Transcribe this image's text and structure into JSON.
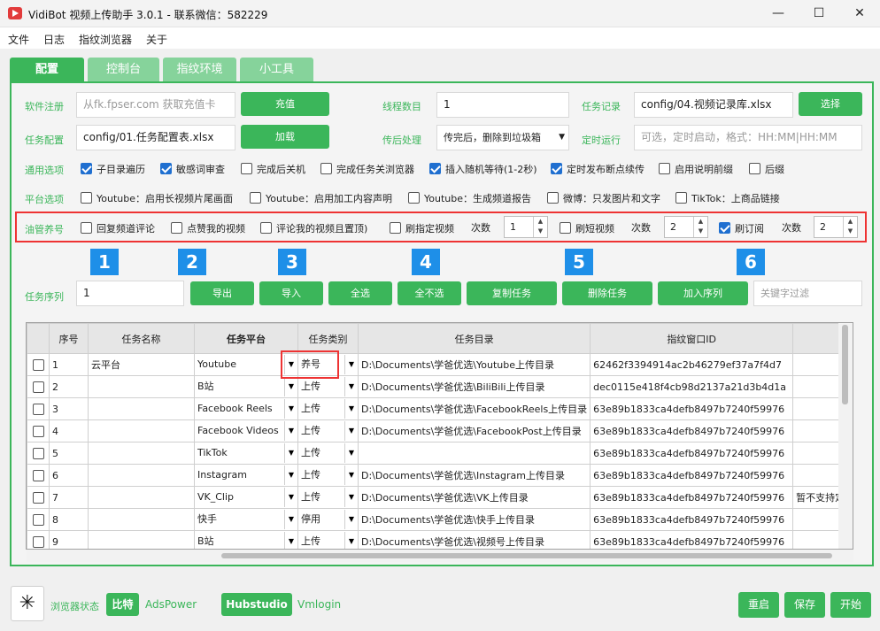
{
  "window": {
    "title": "VidiBot 视频上传助手 3.0.1 - 联系微信：582229"
  },
  "menu": [
    "文件",
    "日志",
    "指纹浏览器",
    "关于"
  ],
  "tabs": [
    "配置",
    "控制台",
    "指纹环境",
    "小工具"
  ],
  "config": {
    "reg_label": "软件注册",
    "reg_placeholder": "从fk.fpser.com 获取充值卡",
    "recharge_btn": "充值",
    "thread_label": "线程数目",
    "thread_value": "1",
    "record_label": "任务记录",
    "record_value": "config/04.视频记录库.xlsx",
    "select_btn": "选择",
    "task_config_label": "任务配置",
    "task_config_value": "config/01.任务配置表.xlsx",
    "load_btn": "加载",
    "post_label": "传后处理",
    "post_value": "传完后，删除到垃圾箱",
    "schedule_label": "定时运行",
    "schedule_placeholder": "可选，定时启动，格式：HH:MM|HH:MM"
  },
  "general": {
    "label": "通用选项",
    "options": [
      {
        "text": "子目录遍历",
        "checked": true
      },
      {
        "text": "敏感词审查",
        "checked": true
      },
      {
        "text": "完成后关机",
        "checked": false
      },
      {
        "text": "完成任务关浏览器",
        "checked": false
      },
      {
        "text": "插入随机等待(1-2秒)",
        "checked": true
      },
      {
        "text": "定时发布断点续传",
        "checked": true
      },
      {
        "text": "启用说明前缀",
        "checked": false
      },
      {
        "text": "后缀",
        "checked": false
      }
    ]
  },
  "platform": {
    "label": "平台选项",
    "options": [
      {
        "text": "Youtube：启用长视频片尾画面",
        "checked": false
      },
      {
        "text": "Youtube：启用加工内容声明",
        "checked": false
      },
      {
        "text": "Youtube：生成频道报告",
        "checked": false
      },
      {
        "text": "微博：只发图片和文字",
        "checked": false
      },
      {
        "text": "TikTok：上商品链接",
        "checked": false
      }
    ]
  },
  "youtube_boost": {
    "label": "油管养号",
    "opt1": "回复频道评论",
    "opt2": "点赞我的视频",
    "opt3": "评论我的视频且置顶)",
    "opt4": "刷指定视频",
    "count_label": "次数",
    "count1": "1",
    "opt5": "刷短视频",
    "count2": "2",
    "opt6": "刷订阅",
    "count3": "2",
    "opt6_checked": true
  },
  "badges": [
    "1",
    "2",
    "3",
    "4",
    "5",
    "6"
  ],
  "sequence": {
    "label": "任务序列",
    "value": "1",
    "buttons": [
      "导出",
      "导入",
      "全选",
      "全不选",
      "复制任务",
      "删除任务",
      "加入序列"
    ],
    "filter_placeholder": "关键字过滤"
  },
  "table": {
    "headers": [
      "序号",
      "任务名称",
      "任务平台",
      "任务类别",
      "任务目录",
      "指纹窗口ID",
      ""
    ],
    "rows": [
      [
        "1",
        "云平台",
        "Youtube",
        "养号",
        "D:\\Documents\\学爸优选\\Youtube上传目录",
        "62462f3394914ac2b46279ef37a7f4d7",
        ""
      ],
      [
        "2",
        "",
        "B站",
        "上传",
        "D:\\Documents\\学爸优选\\BiliBili上传目录",
        "dec0115e418f4cb98d2137a21d3b4d1a",
        ""
      ],
      [
        "3",
        "",
        "Facebook Reels",
        "上传",
        "D:\\Documents\\学爸优选\\FacebookReels上传目录",
        "63e89b1833ca4defb8497b7240f59976",
        ""
      ],
      [
        "4",
        "",
        "Facebook Videos",
        "上传",
        "D:\\Documents\\学爸优选\\FacebookPost上传目录",
        "63e89b1833ca4defb8497b7240f59976",
        ""
      ],
      [
        "5",
        "",
        "TikTok",
        "上传",
        "",
        "63e89b1833ca4defb8497b7240f59976",
        ""
      ],
      [
        "6",
        "",
        "Instagram",
        "上传",
        "D:\\Documents\\学爸优选\\Instagram上传目录",
        "63e89b1833ca4defb8497b7240f59976",
        ""
      ],
      [
        "7",
        "",
        "VK_Clip",
        "上传",
        "D:\\Documents\\学爸优选\\VK上传目录",
        "63e89b1833ca4defb8497b7240f59976",
        "暂不支持定"
      ],
      [
        "8",
        "",
        "快手",
        "停用",
        "D:\\Documents\\学爸优选\\快手上传目录",
        "63e89b1833ca4defb8497b7240f59976",
        ""
      ],
      [
        "9",
        "",
        "B站",
        "上传",
        "D:\\Documents\\学爸优选\\视频号上传目录",
        "63e89b1833ca4defb8497b7240f59976",
        ""
      ]
    ]
  },
  "bottom": {
    "browser_status": "浏览器状态",
    "bitbrowser": "比特",
    "adspower": "AdsPower",
    "hubstudio": "Hubstudio",
    "vmlogin": "Vmlogin",
    "restart": "重启",
    "save": "保存",
    "start": "开始"
  },
  "colors": {
    "accent": "#3bb65a",
    "badge": "#1e8fe8",
    "highlight": "#e33333"
  }
}
